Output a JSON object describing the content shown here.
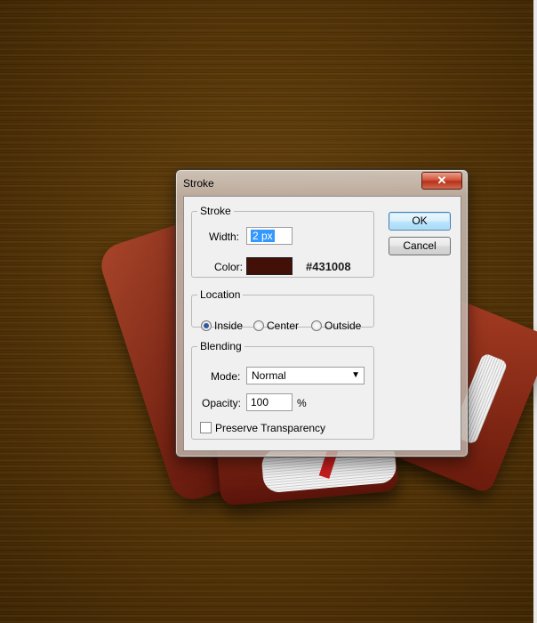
{
  "dialog": {
    "title": "Stroke",
    "close_glyph": "✕",
    "buttons": {
      "ok": "OK",
      "cancel": "Cancel"
    },
    "stroke": {
      "group_label": "Stroke",
      "width_label": "Width:",
      "width_value": "2 px",
      "color_label": "Color:",
      "color_hex": "#431008",
      "swatch_color": "#431008"
    },
    "location": {
      "group_label": "Location",
      "options": [
        "Inside",
        "Center",
        "Outside"
      ],
      "selected": "Inside"
    },
    "blending": {
      "group_label": "Blending",
      "mode_label": "Mode:",
      "mode_value": "Normal",
      "opacity_label": "Opacity:",
      "opacity_value": "100",
      "opacity_unit": "%",
      "preserve_label": "Preserve Transparency",
      "preserve_checked": false
    }
  }
}
